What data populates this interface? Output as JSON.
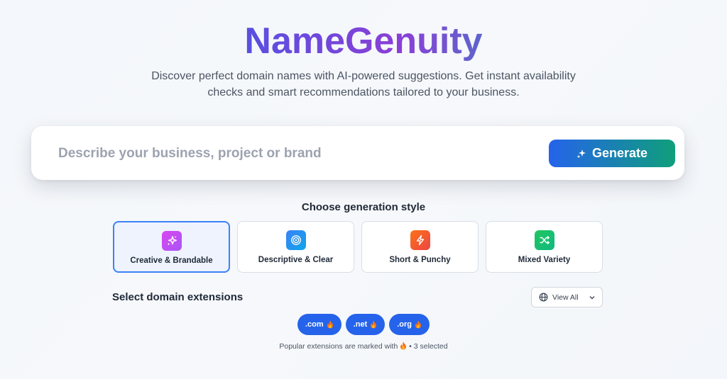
{
  "header": {
    "title": "NameGenuity",
    "subtitle": "Discover perfect domain names with AI-powered suggestions. Get instant availability checks and smart recommendations tailored to your business."
  },
  "search": {
    "placeholder": "Describe your business, project or brand",
    "value": "",
    "generate_label": "Generate",
    "generate_icon": "sparkle-icon"
  },
  "styles": {
    "heading": "Choose generation style",
    "selected": "Creative & Brandable",
    "options": [
      {
        "label": "Creative & Brandable",
        "icon": "sparkle-icon",
        "color": "#c94fd6"
      },
      {
        "label": "Descriptive & Clear",
        "icon": "target-icon",
        "color": "#3b82f6"
      },
      {
        "label": "Short & Punchy",
        "icon": "lightning-icon",
        "color": "#f97316"
      },
      {
        "label": "Mixed Variety",
        "icon": "shuffle-icon",
        "color": "#22a86b"
      }
    ]
  },
  "extensions": {
    "heading": "Select domain extensions",
    "view_all_label": "View All",
    "items": [
      {
        "label": ".com",
        "popular": true
      },
      {
        "label": ".net",
        "popular": true
      },
      {
        "label": ".org",
        "popular": true
      }
    ],
    "footnote_prefix": "Popular extensions are marked with",
    "footnote_suffix": "• 3 selected"
  },
  "colors": {
    "primary": "#2563eb",
    "accent_green": "#0f9f7a",
    "selected_bg": "#eef3fe",
    "flame": "#f97316"
  }
}
